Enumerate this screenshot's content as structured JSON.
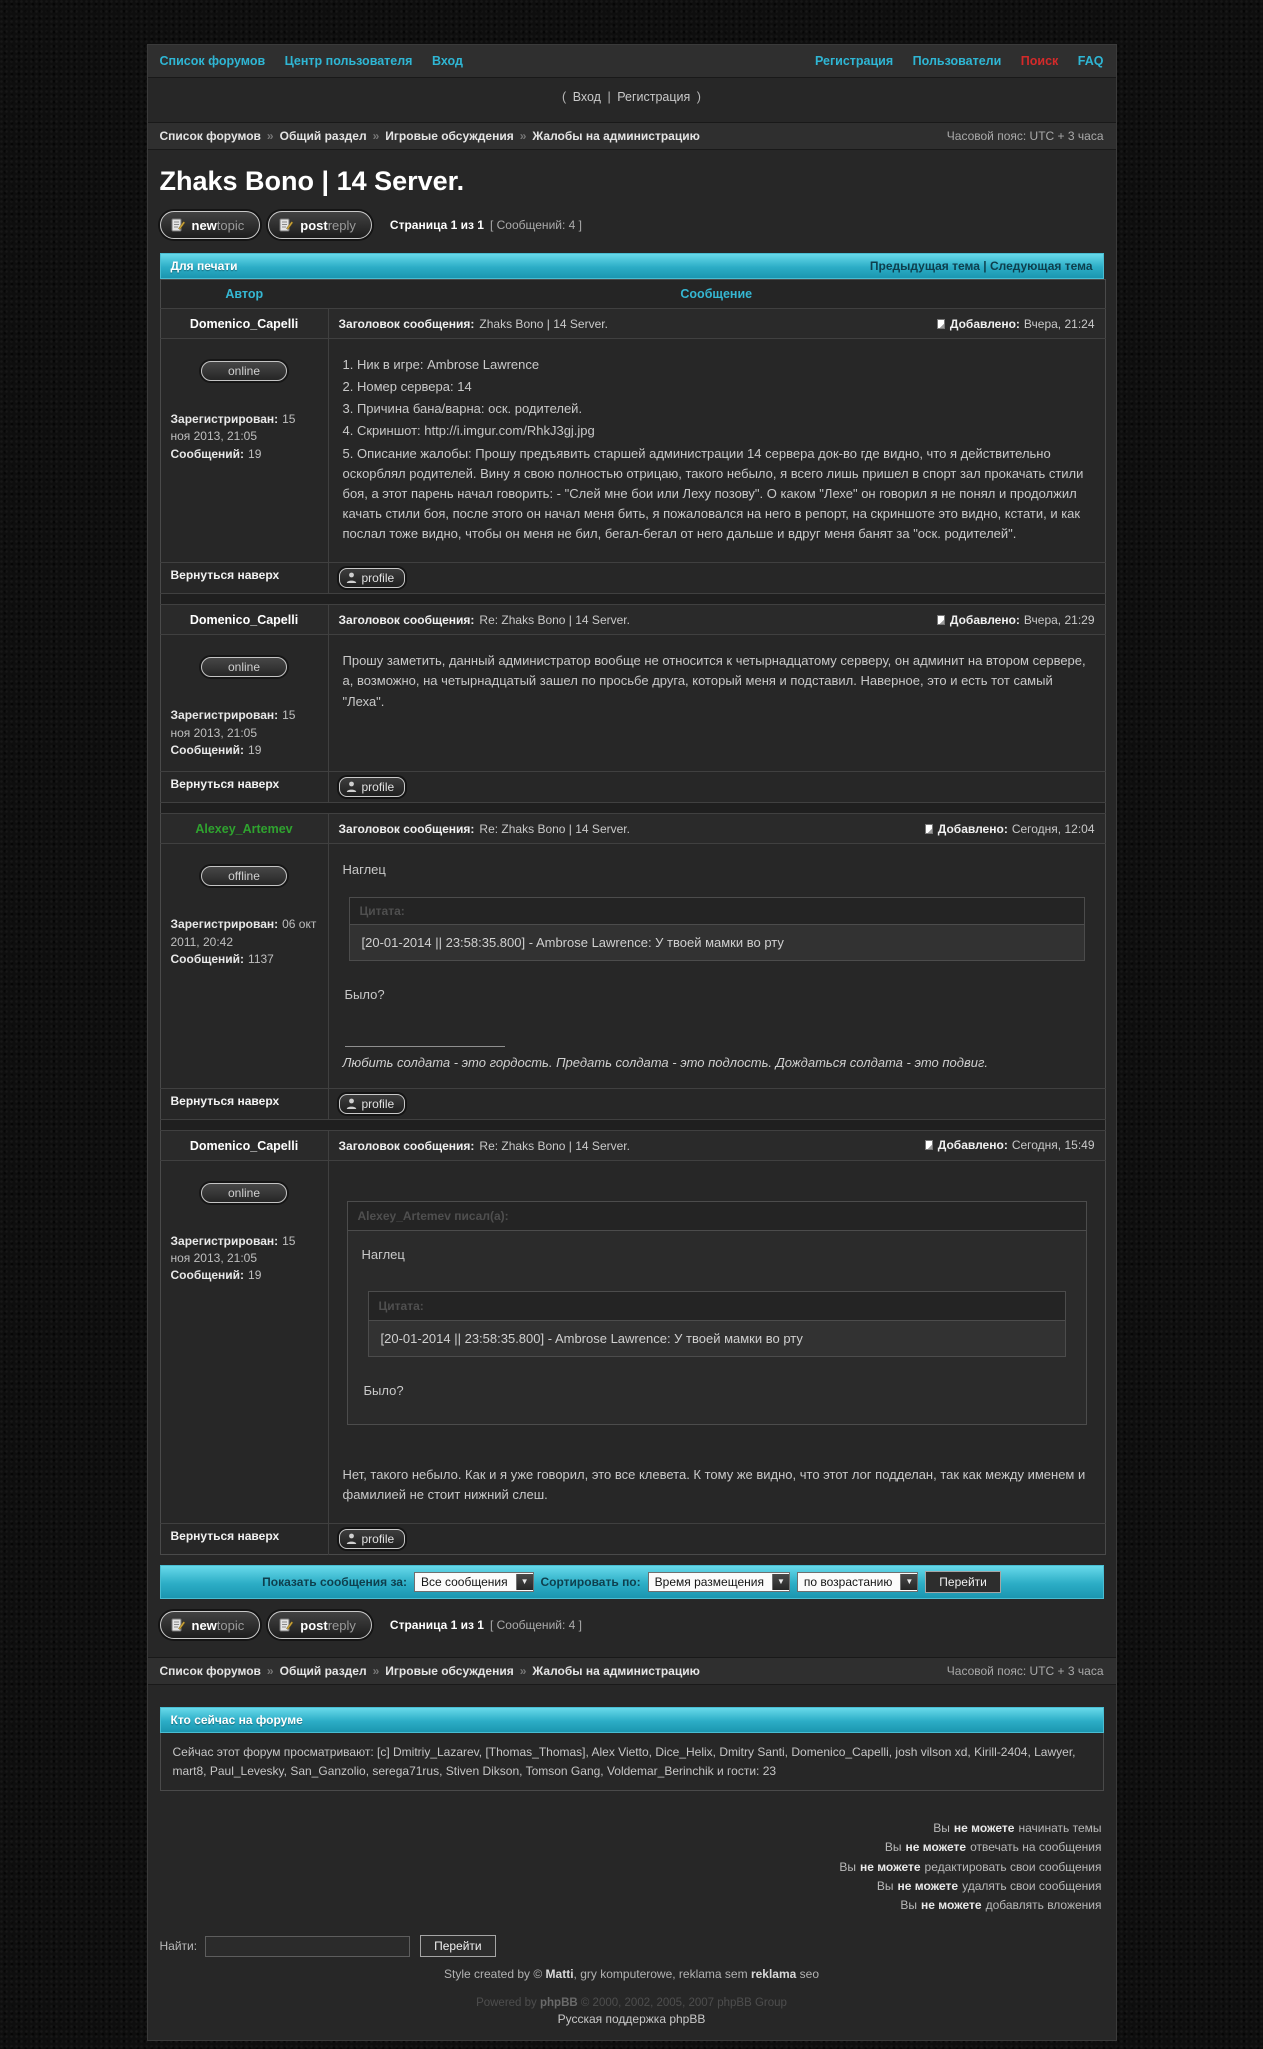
{
  "colors": {
    "accent_cyan": "#2fb6d4",
    "accent_red": "#d42a2a",
    "username_green": "#2fa32f",
    "bar_gradient_top": "#67d9ea",
    "bar_gradient_bottom": "#1b96b0"
  },
  "topnav": {
    "left": [
      "Список форумов",
      "Центр пользователя",
      "Вход"
    ],
    "right": [
      "Регистрация",
      "Пользователи",
      "Поиск",
      "FAQ"
    ]
  },
  "login_line": {
    "prefix": "(",
    "login": "Вход",
    "separator": "|",
    "register": "Регистрация",
    "suffix": ")"
  },
  "breadcrumb": {
    "items": [
      "Список форумов",
      "Общий раздел",
      "Игровые обсуждения",
      "Жалобы на администрацию"
    ],
    "separator": "»",
    "timezone": "Часовой пояс: UTC + 3 часа"
  },
  "topic": {
    "title": "Zhaks Bono | 14 Server.",
    "page": "Страница 1 из 1",
    "count": "[ Сообщений: 4 ]"
  },
  "buttons": {
    "new_a": "new",
    "new_b": "topic",
    "reply_a": "post",
    "reply_b": "reply",
    "profile": "profile",
    "go": "Перейти"
  },
  "print_bar": {
    "left": "Для печати",
    "prev": "Предыдущая тема",
    "divider": "|",
    "next": "Следующая тема"
  },
  "table_header": {
    "author": "Автор",
    "message": "Сообщение"
  },
  "labels": {
    "subject": "Заголовок сообщения:",
    "added": "Добавлено:",
    "registered": "Зарегистрирован:",
    "messages": "Сообщений:",
    "back_to_top": "Вернуться наверх",
    "quote": "Цитата:"
  },
  "posts": [
    {
      "author": "Domenico_Capelli",
      "name_color": "#ffffff",
      "status": "online",
      "registered": "15 ноя 2013, 21:05",
      "messages": "19",
      "subject": "Zhaks Bono | 14 Server.",
      "added": "Вчера, 21:24",
      "lines": [
        "1. Ник в игре: Ambrose Lawrence",
        "2. Номер сервера: 14",
        "3. Причина бана/варна: оск. родителей.",
        "4. Скриншот: http://i.imgur.com/RhkJ3gj.jpg",
        "5. Описание жалобы: Прошу предъявить старшей администрации 14 сервера док-во где видно, что я действительно оскорблял родителей. Вину я свою полностью отрицаю, такого небыло, я всего лишь пришел в спорт зал прокачать стили боя, а этот парень начал говорить: - \"Слей мне бои или Леху позову\". О каком \"Лехе\" он говорил я не понял и продолжил качать стили боя, после этого он начал меня бить, я пожаловался на него в репорт, на скриншоте это видно, кстати, и как послал тоже видно, чтобы он меня не бил, бегал-бегал от него дальше и вдруг меня банят за \"оск. родителей\"."
      ]
    },
    {
      "author": "Domenico_Capelli",
      "name_color": "#ffffff",
      "status": "online",
      "registered": "15 ноя 2013, 21:05",
      "messages": "19",
      "subject": "Re: Zhaks Bono | 14 Server.",
      "added": "Вчера, 21:29",
      "text": "Прошу заметить, данный администратор вообще не относится к четырнадцатому серверу, он админит на втором сервере, а, возможно, на четырнадцатый зашел по просьбе друга, который меня и подставил. Наверное, это и есть тот самый \"Леха\"."
    },
    {
      "author": "Alexey_Artemev",
      "name_color": "#2fa32f",
      "status": "offline",
      "registered": "06 окт 2011, 20:42",
      "messages": "1137",
      "subject": "Re: Zhaks Bono | 14 Server.",
      "added": "Сегодня, 12:04",
      "body1": "Наглец",
      "quote_header": "Цитата:",
      "quote_text": "[20-01-2014 || 23:58:35.800] - Ambrose Lawrence: У твоей мамки во рту",
      "body2": "Было?",
      "signature": "Любить солдата - это гордость. Предать солдата - это подлость. Дождаться солдата - это подвиг."
    },
    {
      "author": "Domenico_Capelli",
      "name_color": "#ffffff",
      "status": "online",
      "registered": "15 ноя 2013, 21:05",
      "messages": "19",
      "subject": "Re: Zhaks Bono | 14 Server.",
      "added": "Сегодня, 15:49",
      "outer_quote_header": "Alexey_Artemev писал(а):",
      "body1": "Наглец",
      "quote_header": "Цитата:",
      "quote_text": "[20-01-2014 || 23:58:35.800] - Ambrose Lawrence: У твоей мамки во рту",
      "body2": "Было?",
      "text": "Нет, такого небыло. Как и я уже говорил, это все клевета. К тому же видно, что этот лог подделан, так как между именем и фамилией не стоит нижний слеш."
    }
  ],
  "sort_bar": {
    "show_label": "Показать сообщения за:",
    "show_value": "Все сообщения",
    "sort_label": "Сортировать по:",
    "sort_value": "Время размещения",
    "order_value": "по возрастанию",
    "go": "Перейти"
  },
  "whois": {
    "title": "Кто сейчас на форуме",
    "text": "Сейчас этот форум просматривают: [c] Dmitriy_Lazarev, [Thomas_Thomas], Alex Vietto, Dice_Helix, Dmitry Santi, Domenico_Capelli, josh vilson xd, Kirill-2404, Lawyer, mart8, Paul_Levesky, San_Ganzolio, serega71rus, Stiven Dikson, Tomson Gang, Voldemar_Berinchik и гости: 23"
  },
  "permissions": [
    {
      "pre": "Вы",
      "bold": "не можете",
      "rest": "начинать темы"
    },
    {
      "pre": "Вы",
      "bold": "не можете",
      "rest": "отвечать на сообщения"
    },
    {
      "pre": "Вы",
      "bold": "не можете",
      "rest": "редактировать свои сообщения"
    },
    {
      "pre": "Вы",
      "bold": "не можете",
      "rest": "удалять свои сообщения"
    },
    {
      "pre": "Вы",
      "bold": "не можете",
      "rest": "добавлять вложения"
    }
  ],
  "footer": {
    "find_label": "Найти:",
    "go": "Перейти",
    "style_credit": {
      "p1": "Style created by © ",
      "b1": "Matti",
      "p2": ", gry komputerowe, reklama sem ",
      "b2": "reklama",
      "p3": " seo"
    },
    "powered": {
      "p1": "Powered by ",
      "b": "phpBB",
      "p2": " © 2000, 2002, 2005, 2007 phpBB Group"
    },
    "ru_support": "Русская поддержка phpBB"
  }
}
